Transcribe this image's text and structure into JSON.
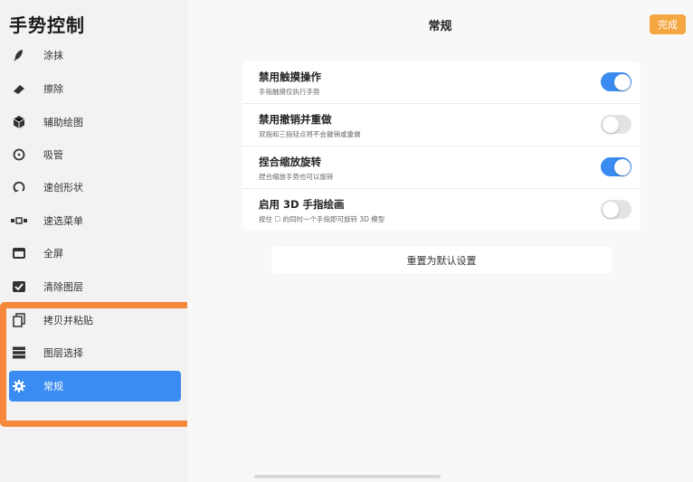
{
  "sidebar": {
    "title": "手势控制",
    "items": [
      {
        "label": "涂抹",
        "icon": "smudge-icon"
      },
      {
        "label": "擦除",
        "icon": "eraser-icon"
      },
      {
        "label": "辅助绘图",
        "icon": "cube-icon"
      },
      {
        "label": "吸管",
        "icon": "eyedropper-icon"
      },
      {
        "label": "速创形状",
        "icon": "quickshape-icon"
      },
      {
        "label": "速选菜单",
        "icon": "quickmenu-icon"
      },
      {
        "label": "全屏",
        "icon": "fullscreen-icon"
      },
      {
        "label": "清除图层",
        "icon": "check-icon"
      },
      {
        "label": "拷贝并粘贴",
        "icon": "copy-icon"
      },
      {
        "label": "图层选择",
        "icon": "layers-icon"
      },
      {
        "label": "常规",
        "icon": "gear-icon",
        "active": true
      }
    ]
  },
  "header": {
    "title": "常规",
    "done_label": "完成"
  },
  "settings": [
    {
      "title": "禁用触摸操作",
      "subtitle": "手指触摸仅执行手势",
      "enabled": true
    },
    {
      "title": "禁用撤销并重做",
      "subtitle": "双指和三指轻点将不会撤销或重做",
      "enabled": false
    },
    {
      "title": "捏合缩放旋转",
      "subtitle": "捏合缩放手势也可以旋转",
      "enabled": true
    },
    {
      "title": "启用 3D 手指绘画",
      "subtitle": "按住 ☐ 的同时一个手指即可旋转 3D 模型",
      "enabled": false
    }
  ],
  "reset_label": "重置为默认设置",
  "colors": {
    "accent": "#3a8cf2",
    "done": "#f4a640",
    "highlight": "#f5883a"
  }
}
